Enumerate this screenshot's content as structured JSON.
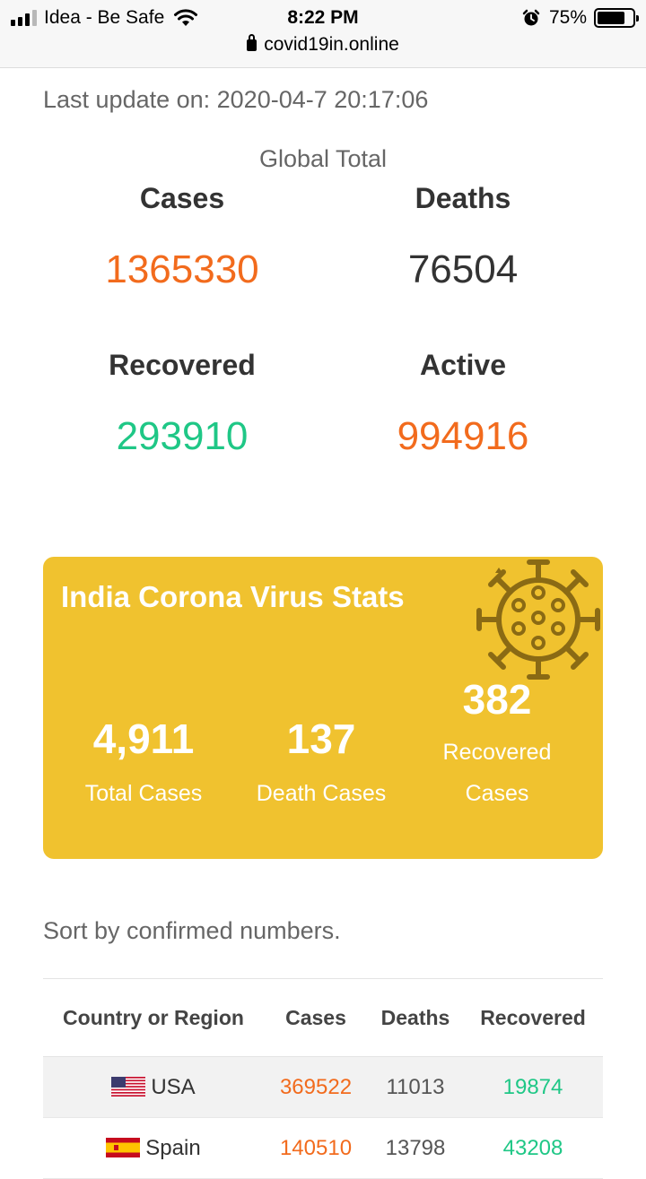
{
  "status_bar": {
    "carrier": "Idea - Be Safe",
    "time": "8:22 PM",
    "battery": "75%",
    "battery_level": 0.75,
    "url": "covid19in.online"
  },
  "last_update": "Last update on: 2020-04-7 20:17:06",
  "global": {
    "title": "Global Total",
    "cases_label": "Cases",
    "cases_value": "1365330",
    "deaths_label": "Deaths",
    "deaths_value": "76504",
    "recovered_label": "Recovered",
    "recovered_value": "293910",
    "active_label": "Active",
    "active_value": "994916"
  },
  "india": {
    "title": "India Corona Virus Stats",
    "total_cases": "4,911",
    "total_cases_label": "Total Cases",
    "death_cases": "137",
    "death_cases_label": "Death Cases",
    "recovered": "382",
    "recovered_label_1": "Recovered",
    "recovered_label_2": "Cases"
  },
  "sort_text": "Sort by confirmed numbers.",
  "table": {
    "headers": [
      "Country or Region",
      "Cases",
      "Deaths",
      "Recovered"
    ],
    "rows": [
      {
        "country": "USA",
        "cases": "369522",
        "deaths": "11013",
        "recovered": "19874"
      },
      {
        "country": "Spain",
        "cases": "140510",
        "deaths": "13798",
        "recovered": "43208"
      }
    ]
  },
  "colors": {
    "orange": "#f26b1d",
    "green": "#1fc786",
    "dark": "#333333",
    "card_yellow": "#f0c22f",
    "virus_brown": "#8a6a14"
  },
  "icons": [
    "signal-icon",
    "wifi-icon",
    "alarm-icon",
    "battery-icon",
    "lock-icon",
    "virus-icon",
    "us-flag-icon",
    "spain-flag-icon"
  ]
}
